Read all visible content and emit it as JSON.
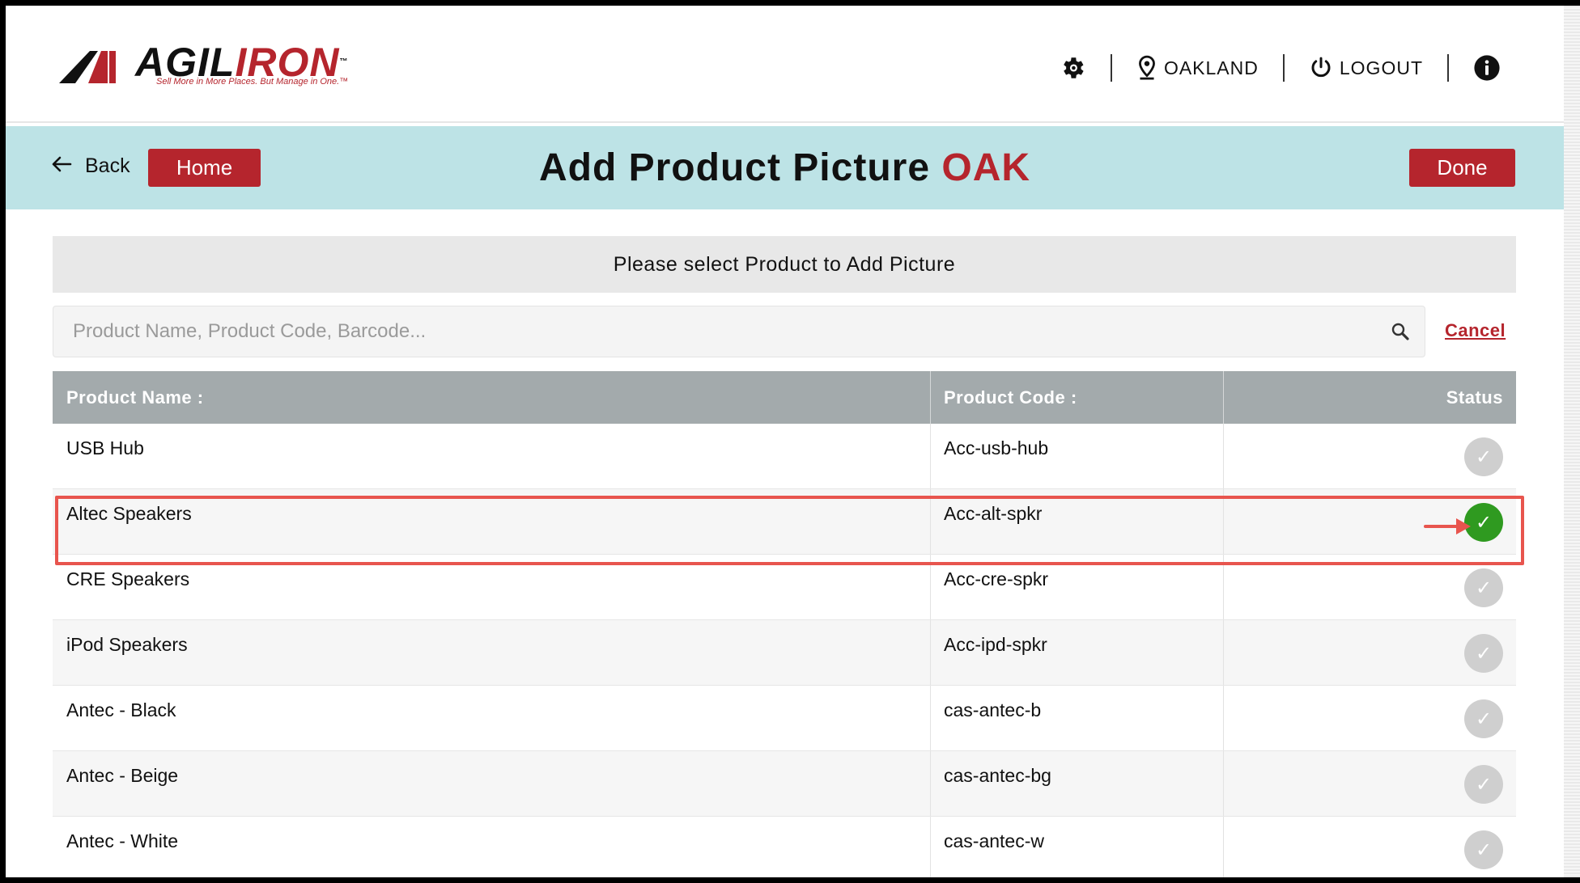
{
  "brand": {
    "name_part1": "AGIL",
    "name_part2": "IRON",
    "tagline": "Sell More in More Places. But Manage in One.™"
  },
  "topnav": {
    "settings_icon": "gear-icon",
    "location_label": "OAKLAND",
    "logout_label": "LOGOUT",
    "info_icon": "info-icon"
  },
  "header": {
    "back_label": "Back",
    "home_label": "Home",
    "title": "Add Product Picture",
    "location_code": "OAK",
    "done_label": "Done"
  },
  "prompt": "Please select Product to Add Picture",
  "search": {
    "placeholder": "Product Name, Product Code, Barcode...",
    "value": "",
    "cancel_label": "Cancel"
  },
  "table": {
    "columns": [
      "Product Name :",
      "Product Code :",
      "Status"
    ],
    "rows": [
      {
        "name": "USB Hub",
        "code": "Acc-usb-hub",
        "selected": false
      },
      {
        "name": "Altec Speakers",
        "code": "Acc-alt-spkr",
        "selected": true
      },
      {
        "name": "CRE Speakers",
        "code": "Acc-cre-spkr",
        "selected": false
      },
      {
        "name": "iPod Speakers",
        "code": "Acc-ipd-spkr",
        "selected": false
      },
      {
        "name": "Antec - Black",
        "code": "cas-antec-b",
        "selected": false
      },
      {
        "name": "Antec - Beige",
        "code": "cas-antec-bg",
        "selected": false
      },
      {
        "name": "Antec - White",
        "code": "cas-antec-w",
        "selected": false
      }
    ]
  },
  "colors": {
    "brand_red": "#b5252d",
    "band": "#bde3e6",
    "selected_check": "#2f9a20",
    "annotation": "#e8554e"
  }
}
